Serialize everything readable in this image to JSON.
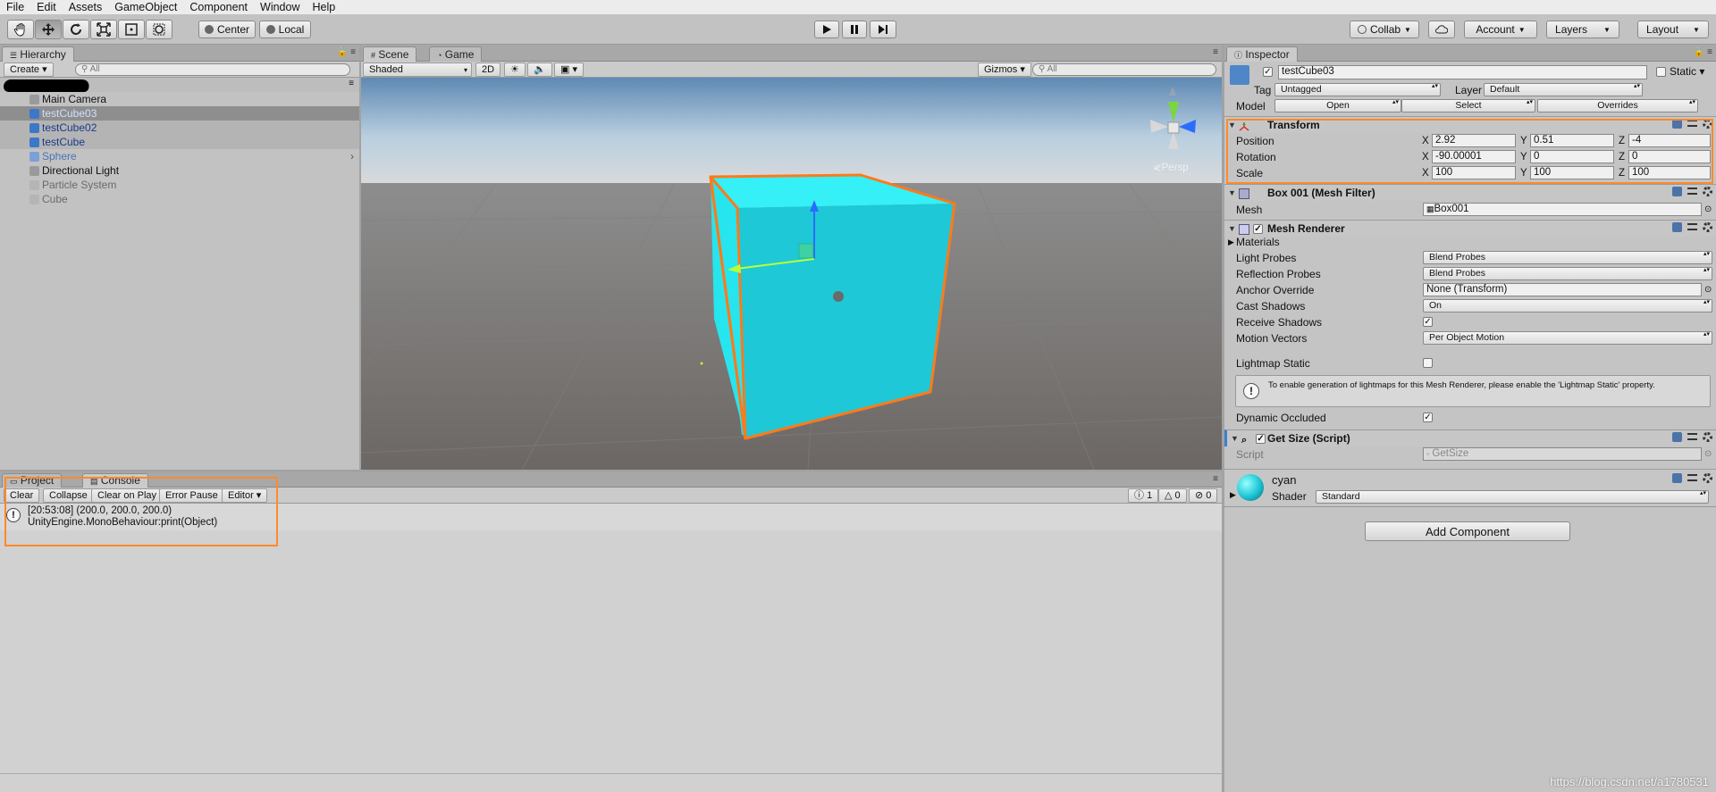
{
  "menu": [
    "File",
    "Edit",
    "Assets",
    "GameObject",
    "Component",
    "Window",
    "Help"
  ],
  "toolbar": {
    "pivot_center": "Center",
    "pivot_local": "Local",
    "collab": "Collab",
    "account": "Account",
    "layers": "Layers",
    "layout": "Layout"
  },
  "hierarchy": {
    "tab": "Hierarchy",
    "create": "Create",
    "search_placeholder": "All",
    "items": [
      {
        "label": "Main Camera",
        "state": "normal"
      },
      {
        "label": "testCube03",
        "state": "selected"
      },
      {
        "label": "testCube02",
        "state": "selected"
      },
      {
        "label": "testCube",
        "state": "selected"
      },
      {
        "label": "Sphere",
        "state": "prefab"
      },
      {
        "label": "Directional Light",
        "state": "normal"
      },
      {
        "label": "Particle System",
        "state": "disabled"
      },
      {
        "label": "Cube",
        "state": "disabled"
      }
    ]
  },
  "scene": {
    "tab_scene": "Scene",
    "tab_game": "Game",
    "shading": "Shaded",
    "mode_2d": "2D",
    "gizmos": "Gizmos",
    "search_placeholder": "All",
    "persp": "Persp"
  },
  "console": {
    "tab_project": "Project",
    "tab_console": "Console",
    "buttons": [
      "Clear",
      "Collapse",
      "Clear on Play",
      "Error Pause",
      "Editor"
    ],
    "count_info": "1",
    "count_warn": "0",
    "count_error": "0",
    "log_line1": "[20:53:08] (200.0, 200.0, 200.0)",
    "log_line2": "UnityEngine.MonoBehaviour:print(Object)"
  },
  "inspector": {
    "tab": "Inspector",
    "object_name": "testCube03",
    "static_label": "Static",
    "tag_label": "Tag",
    "tag_value": "Untagged",
    "layer_label": "Layer",
    "layer_value": "Default",
    "model_label": "Model",
    "model_open": "Open",
    "model_select": "Select",
    "model_overrides": "Overrides",
    "transform": {
      "title": "Transform",
      "position_label": "Position",
      "px": "2.92",
      "py": "0.51",
      "pz": "-4",
      "rotation_label": "Rotation",
      "rx": "-90.00001",
      "ry": "0",
      "rz": "0",
      "scale_label": "Scale",
      "sx": "100",
      "sy": "100",
      "sz": "100"
    },
    "mesh_filter": {
      "title": "Box 001 (Mesh Filter)",
      "mesh_label": "Mesh",
      "mesh_value": "Box001"
    },
    "mesh_renderer": {
      "title": "Mesh Renderer",
      "materials": "Materials",
      "light_probes_label": "Light Probes",
      "light_probes": "Blend Probes",
      "reflection_probes_label": "Reflection Probes",
      "reflection_probes": "Blend Probes",
      "anchor_label": "Anchor Override",
      "anchor": "None (Transform)",
      "cast_label": "Cast Shadows",
      "cast": "On",
      "receive_label": "Receive Shadows",
      "motion_label": "Motion Vectors",
      "motion": "Per Object Motion",
      "lightmap_label": "Lightmap Static",
      "info": "To enable generation of lightmaps for this Mesh Renderer, please enable the 'Lightmap Static' property.",
      "dynamic_label": "Dynamic Occluded"
    },
    "script": {
      "title": "Get Size (Script)",
      "label": "Script",
      "value": "GetSize"
    },
    "material": {
      "name": "cyan",
      "shader_label": "Shader",
      "shader": "Standard"
    },
    "add_component": "Add Component"
  },
  "watermark": "https://blog.csdn.net/a1780531",
  "colors": {
    "selection": "#ff8a2b",
    "cube": "#1ec8d6",
    "cube_top": "#35f0f6"
  }
}
